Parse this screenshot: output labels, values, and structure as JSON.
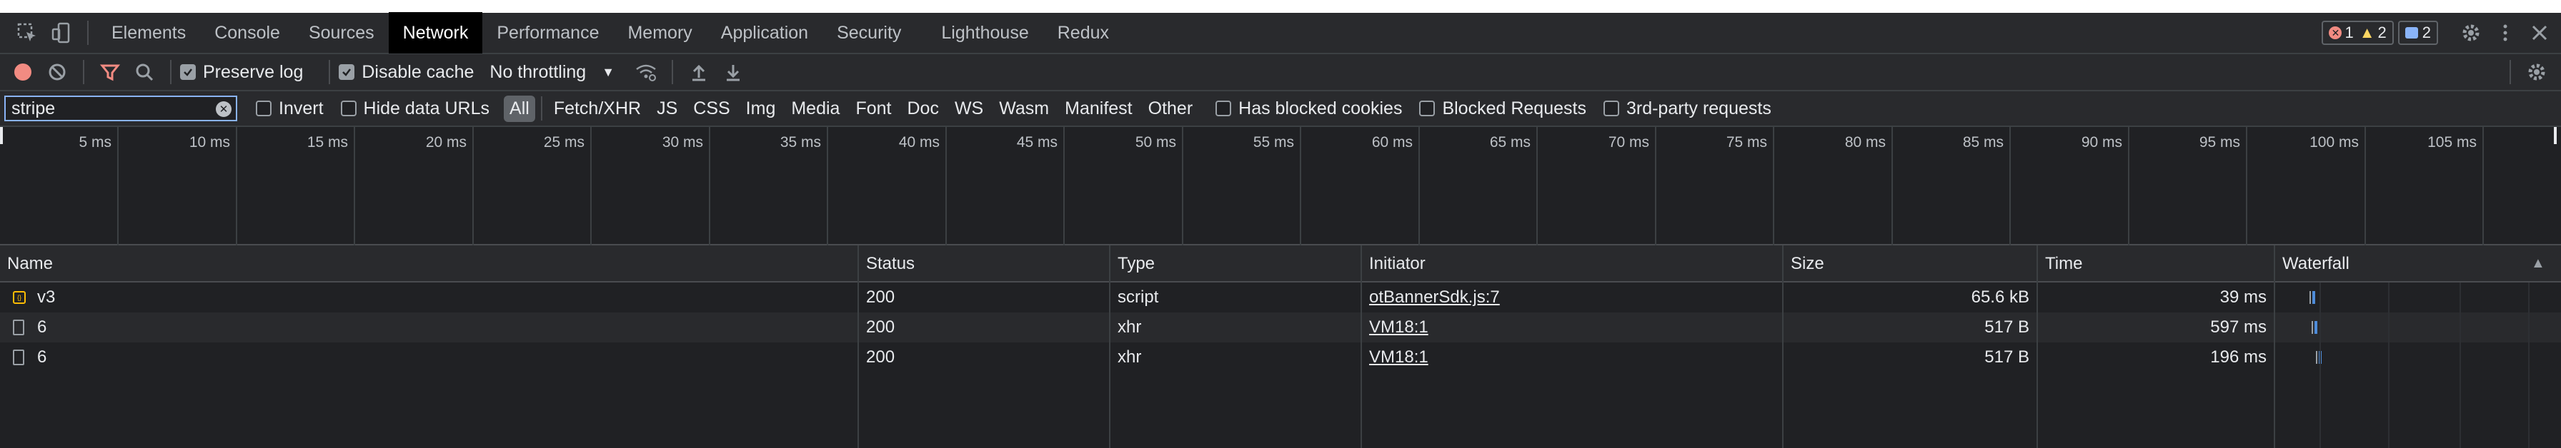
{
  "tabs": [
    {
      "label": "Elements"
    },
    {
      "label": "Console"
    },
    {
      "label": "Sources"
    },
    {
      "label": "Network",
      "active": true
    },
    {
      "label": "Performance"
    },
    {
      "label": "Memory"
    },
    {
      "label": "Application"
    },
    {
      "label": "Security"
    },
    {
      "label": "Lighthouse"
    },
    {
      "label": "Redux"
    }
  ],
  "badges": {
    "errors": "1",
    "warnings": "2",
    "messages": "2"
  },
  "toolbar": {
    "preserve_log": "Preserve log",
    "disable_cache": "Disable cache",
    "throttling": "No throttling"
  },
  "filter": {
    "value": "stripe",
    "invert": "Invert",
    "hide_data_urls": "Hide data URLs",
    "types": [
      "All",
      "Fetch/XHR",
      "JS",
      "CSS",
      "Img",
      "Media",
      "Font",
      "Doc",
      "WS",
      "Wasm",
      "Manifest",
      "Other"
    ],
    "active_type": "All",
    "has_blocked_cookies": "Has blocked cookies",
    "blocked_requests": "Blocked Requests",
    "third_party": "3rd-party requests"
  },
  "timeline": {
    "ticks": [
      "5 ms",
      "10 ms",
      "15 ms",
      "20 ms",
      "25 ms",
      "30 ms",
      "35 ms",
      "40 ms",
      "45 ms",
      "50 ms",
      "55 ms",
      "60 ms",
      "65 ms",
      "70 ms",
      "75 ms",
      "80 ms",
      "85 ms",
      "90 ms",
      "95 ms",
      "100 ms",
      "105 ms"
    ]
  },
  "table": {
    "columns": {
      "name": "Name",
      "status": "Status",
      "type": "Type",
      "initiator": "Initiator",
      "size": "Size",
      "time": "Time",
      "waterfall": "Waterfall"
    },
    "rows": [
      {
        "name": "v3",
        "status": "200",
        "type": "script",
        "initiator": "otBannerSdk.js:7",
        "size": "65.6 kB",
        "time": "39 ms",
        "icon": "script-file-icon",
        "waterfall_start_ms": 2,
        "waterfall_duration_ms": 39
      },
      {
        "name": "6",
        "status": "200",
        "type": "xhr",
        "initiator": "VM18:1",
        "size": "517 B",
        "time": "597 ms",
        "icon": "document-file-icon",
        "waterfall_start_ms": 3,
        "waterfall_duration_ms": 597
      },
      {
        "name": "6",
        "status": "200",
        "type": "xhr",
        "initiator": "VM18:1",
        "size": "517 B",
        "time": "196 ms",
        "icon": "document-file-icon",
        "waterfall_start_ms": 6,
        "waterfall_duration_ms": 196
      }
    ]
  },
  "colors": {
    "accent": "#8ab4f8",
    "error": "#f28b82",
    "warning": "#fdd663",
    "record": "#f28b82",
    "script_icon": "#fbbc04",
    "waterfall_bar": "#4e8cd9",
    "waterfall_wait": "#9aa0a6"
  }
}
